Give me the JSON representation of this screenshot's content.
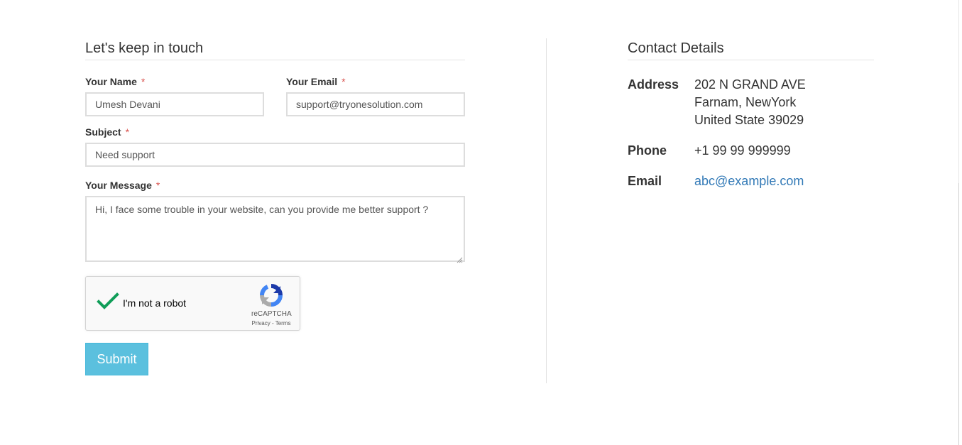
{
  "form": {
    "title": "Let's keep in touch",
    "required_mark": "*",
    "name": {
      "label": "Your Name",
      "value": "Umesh Devani"
    },
    "email": {
      "label": "Your Email",
      "value": "support@tryonesolution.com"
    },
    "subject": {
      "label": "Subject",
      "value": "Need support"
    },
    "message": {
      "label": "Your Message",
      "value": "Hi, I face some trouble in your website, can you provide me better support ?"
    },
    "recaptcha": {
      "label": "I'm not a robot",
      "brand": "reCAPTCHA",
      "privacy": "Privacy",
      "separator": " - ",
      "terms": "Terms",
      "checked": true
    },
    "submit_label": "Submit"
  },
  "contact": {
    "title": "Contact Details",
    "address": {
      "label": "Address",
      "lines": [
        "202 N GRAND AVE",
        "Farnam, NewYork",
        "United State 39029"
      ]
    },
    "phone": {
      "label": "Phone",
      "value": "+1 99 99 999999"
    },
    "email": {
      "label": "Email",
      "value": "abc@example.com"
    }
  },
  "colors": {
    "submit_bg": "#5bc0de",
    "link": "#337ab7",
    "required": "#d9534f",
    "checkmark": "#0f9d58"
  }
}
